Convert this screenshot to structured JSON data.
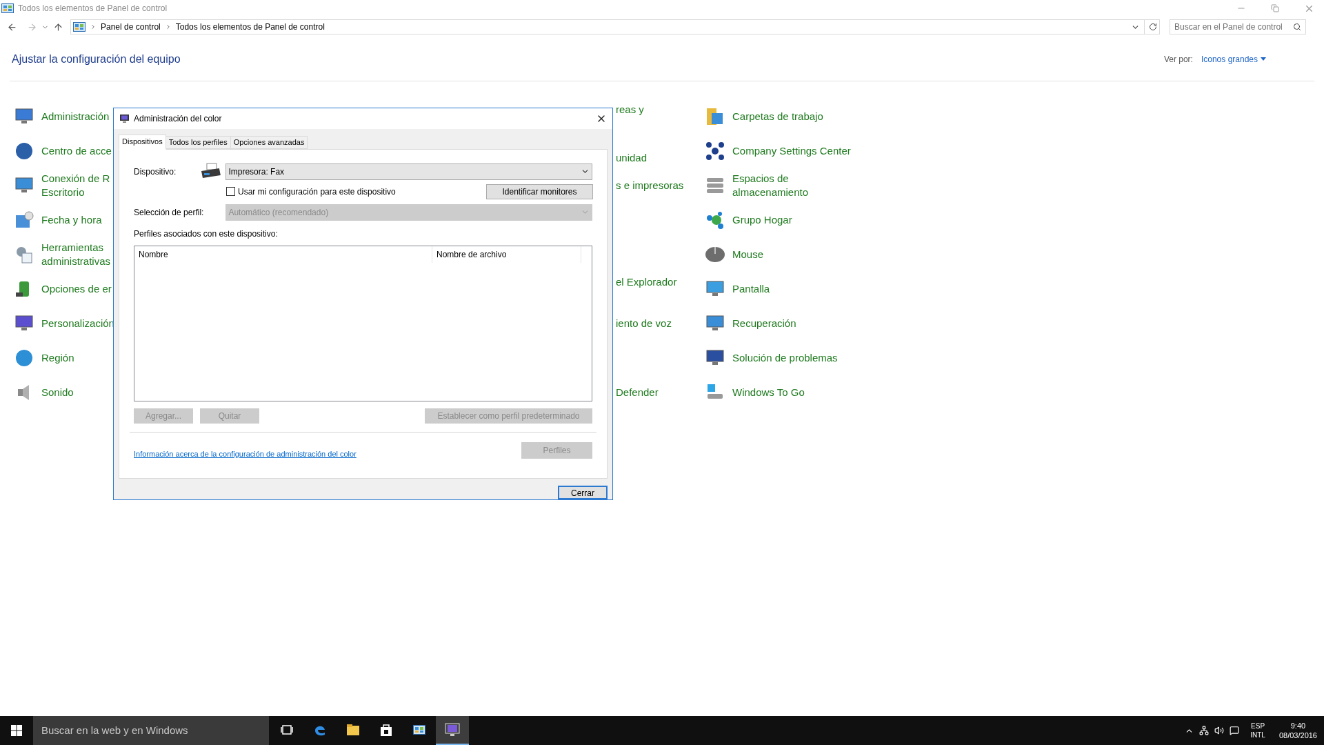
{
  "window": {
    "title": "Todos los elementos de Panel de control"
  },
  "address_bar": {
    "path": [
      "Panel de control",
      "Todos los elementos de Panel de control"
    ],
    "search_placeholder": "Buscar en el Panel de control"
  },
  "heading": "Ajustar la configuración del equipo",
  "view_by": {
    "label": "Ver por:",
    "value": "Iconos grandes"
  },
  "left_items": [
    {
      "lines": [
        "Administración"
      ]
    },
    {
      "lines": [
        "Centro de acce"
      ]
    },
    {
      "lines": [
        "Conexión de R",
        "Escritorio"
      ]
    },
    {
      "lines": [
        "Fecha y hora"
      ]
    },
    {
      "lines": [
        "Herramientas",
        "administrativas"
      ]
    },
    {
      "lines": [
        "Opciones de er"
      ]
    },
    {
      "lines": [
        "Personalización"
      ]
    },
    {
      "lines": [
        "Región"
      ]
    },
    {
      "lines": [
        "Sonido"
      ]
    }
  ],
  "middle_fragments": [
    {
      "kind": "upper",
      "text": "reas y"
    },
    {
      "kind": "lower",
      "text": "unidad"
    },
    {
      "kind": "single",
      "text": "s e impresoras"
    },
    {
      "kind": "hidden"
    },
    {
      "kind": "hidden"
    },
    {
      "kind": "upper",
      "text": "el Explorador"
    },
    {
      "kind": "single",
      "text": "iento de voz"
    },
    {
      "kind": "hidden"
    },
    {
      "kind": "single",
      "text": "Defender"
    }
  ],
  "right_items": [
    {
      "lines": [
        "Carpetas de trabajo"
      ]
    },
    {
      "lines": [
        "Company Settings Center"
      ]
    },
    {
      "lines": [
        "Espacios de",
        "almacenamiento"
      ]
    },
    {
      "lines": [
        "Grupo Hogar"
      ]
    },
    {
      "lines": [
        "Mouse"
      ]
    },
    {
      "lines": [
        "Pantalla"
      ]
    },
    {
      "lines": [
        "Recuperación"
      ]
    },
    {
      "lines": [
        "Solución de problemas"
      ]
    },
    {
      "lines": [
        "Windows To Go"
      ]
    }
  ],
  "dialog": {
    "title": "Administración del color",
    "tabs": [
      {
        "label": "Dispositivos",
        "selected": true
      },
      {
        "label": "Todos los perfiles",
        "selected": false
      },
      {
        "label": "Opciones avanzadas",
        "selected": false
      }
    ],
    "device_label": "Dispositivo:",
    "device_value": "Impresora: Fax",
    "use_settings": {
      "label": "Usar mi configuración para este dispositivo",
      "checked": false
    },
    "identify_button": {
      "label": "Identificar monitores",
      "disabled": false
    },
    "profile_label": "Selección de perfil:",
    "profile_value": "Automático (recomendado)",
    "profile_disabled": true,
    "profiles_label": "Perfiles asociados con este dispositivo:",
    "table": {
      "columns": [
        "Nombre",
        "Nombre de archivo"
      ]
    },
    "action_buttons": [
      {
        "label": "Agregar...",
        "disabled": true
      },
      {
        "label": "Quitar",
        "disabled": true
      },
      {
        "label": "Establecer como perfil predeterminado",
        "disabled": true
      }
    ],
    "link": "Información acerca de la configuración de administración del color",
    "profiles_button": {
      "label": "Perfiles",
      "disabled": true
    },
    "close_button": {
      "label": "Cerrar",
      "disabled": false
    }
  },
  "taskbar": {
    "search_placeholder": "Buscar en la web y en Windows",
    "apps": [
      {
        "kind": "taskview",
        "selected": false
      },
      {
        "kind": "edge",
        "selected": false
      },
      {
        "kind": "explorer",
        "selected": false
      },
      {
        "kind": "store",
        "selected": false
      },
      {
        "kind": "control",
        "selected": false
      },
      {
        "kind": "color",
        "selected": true
      }
    ],
    "language": [
      "ESP",
      "INTL"
    ],
    "time": "9:40",
    "date": "08/03/2016"
  }
}
